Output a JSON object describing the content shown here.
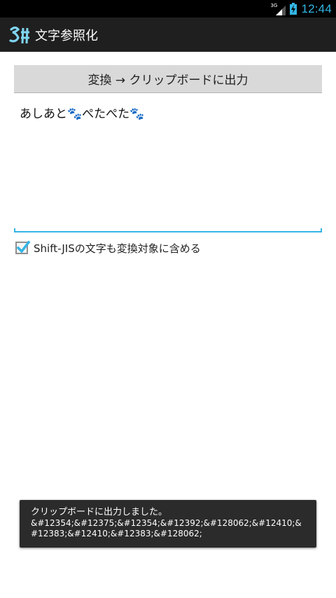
{
  "status_bar": {
    "network_type": "3G",
    "time": "12:44"
  },
  "action_bar": {
    "title": "文字参照化",
    "icon": "app-logo-icon"
  },
  "convert_button": {
    "label": "変換 → クリップボードに出力"
  },
  "text_input": {
    "value": "あしあと🐾ぺたぺた🐾"
  },
  "options": {
    "include_shift_jis": {
      "label": "Shift-JISの文字も変換対象に含める",
      "checked": true
    }
  },
  "toast": {
    "title": "クリップボードに出力しました。",
    "output": "&#12354;&#12375;&#12354;&#12392;&#128062;&#12410;&#12383;&#12410;&#12383;&#128062;"
  },
  "colors": {
    "accent": "#33b5e5",
    "action_bar": "#1f1f1f",
    "button": "#d9d9d9"
  }
}
